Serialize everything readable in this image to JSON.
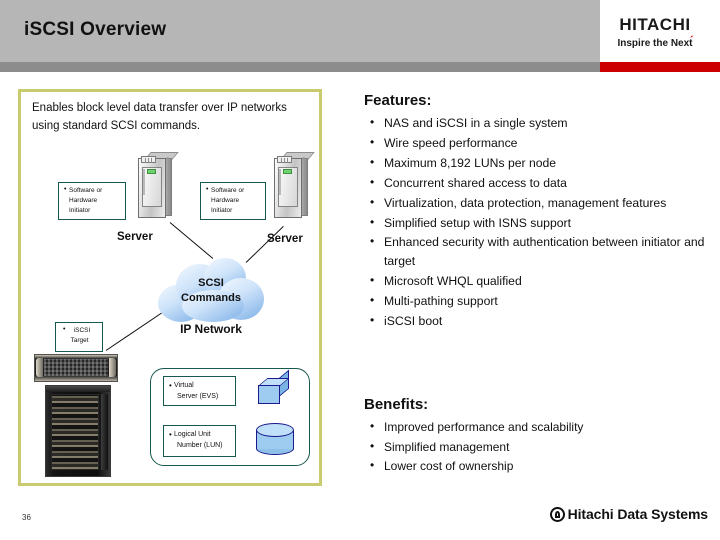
{
  "header": {
    "title": "iSCSI Overview",
    "brand_main": "HITACHI",
    "brand_tagline": "Inspire the Next",
    "accent_gray": "#b6b6b6",
    "accent_red": "#cc0000"
  },
  "diagram": {
    "intro_text": "Enables block level data transfer over IP networks using standard SCSI commands.",
    "panel_border_color": "#c8cc6e",
    "server_left_label": "Server",
    "server_right_label": "Server",
    "callout_initiator_left": {
      "line1": "Software or",
      "line2": "Hardware",
      "line3": "Initiator"
    },
    "callout_initiator_right": {
      "line1": "Software or",
      "line2": "Hardware",
      "line3": "Initiator"
    },
    "callout_target": {
      "line1": "iSCSI",
      "line2": "Target"
    },
    "cloud_line1": "SCSI",
    "cloud_line2": "Commands",
    "cloud_color": "#9cc3ee",
    "ip_network_label": "IP Network",
    "callout_evs": {
      "line1": "Virtual",
      "line2": "Server (EVS)"
    },
    "callout_lun": {
      "line1": "Logical Unit",
      "line2": "Number (LUN)"
    },
    "icon_evs": "cube-icon",
    "icon_lun": "cylinder-icon",
    "icon_fill": "#9ecbf0"
  },
  "features": {
    "heading": "Features:",
    "items": [
      "NAS and iSCSI in a single system",
      "Wire speed performance",
      "Maximum 8,192 LUNs per node",
      "Concurrent shared access to data",
      "Virtualization, data protection, management features",
      "Simplified setup with ISNS support",
      "Enhanced security with authentication between initiator and target",
      "Microsoft WHQL qualified",
      "Multi-pathing support",
      "iSCSI boot"
    ]
  },
  "benefits": {
    "heading": "Benefits:",
    "items": [
      "Improved performance and scalability",
      "Simplified management",
      "Lower cost of ownership"
    ]
  },
  "footer": {
    "page_number": "36",
    "company": "Hitachi Data Systems",
    "logo_icon": "hds-mark-icon"
  }
}
